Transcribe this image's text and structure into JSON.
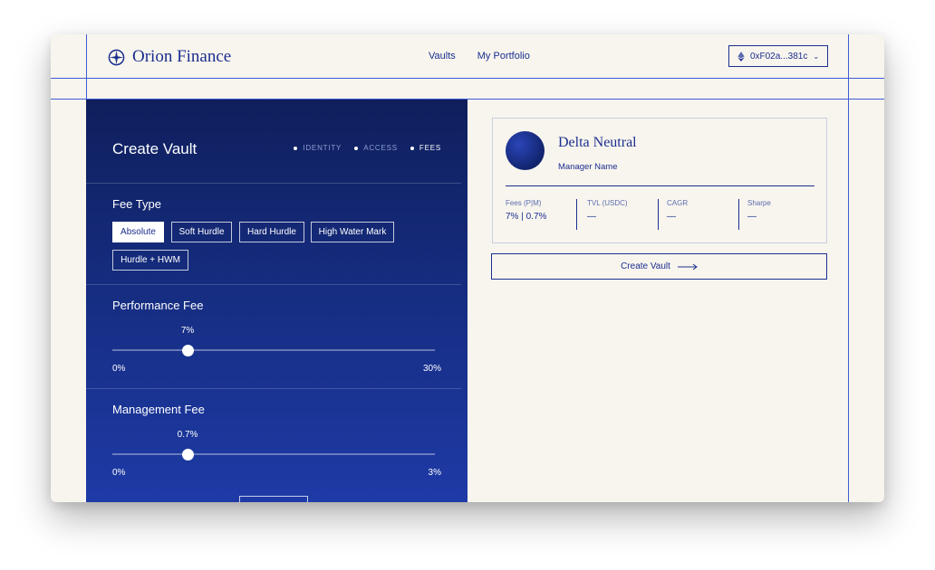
{
  "brand": {
    "name": "Orion Finance"
  },
  "nav": {
    "items": [
      "Vaults",
      "My Portfolio"
    ]
  },
  "wallet": {
    "address": "0xF02a...381c",
    "chevron": "⌄"
  },
  "create_panel": {
    "title": "Create Vault",
    "steps": [
      {
        "label": "IDENTITY",
        "active": false
      },
      {
        "label": "ACCESS",
        "active": false
      },
      {
        "label": "FEES",
        "active": true
      }
    ],
    "fee_type": {
      "title": "Fee Type",
      "options": [
        "Absolute",
        "Soft Hurdle",
        "Hard Hurdle",
        "High Water Mark",
        "Hurdle + HWM"
      ],
      "selected": "Absolute"
    },
    "performance_fee": {
      "title": "Performance Fee",
      "value": "7%",
      "min": "0%",
      "max": "30%",
      "fraction": 0.2333
    },
    "management_fee": {
      "title": "Management Fee",
      "value": "0.7%",
      "min": "0%",
      "max": "3%",
      "fraction": 0.2333
    }
  },
  "preview": {
    "vault_name": "Delta Neutral",
    "manager_name": "Manager Name",
    "stats": [
      {
        "label": "Fees (P|M)",
        "value": "7% | 0.7%"
      },
      {
        "label": "TVL (USDC)",
        "value": "—"
      },
      {
        "label": "CAGR",
        "value": "—"
      },
      {
        "label": "Sharpe",
        "value": "—"
      }
    ]
  },
  "actions": {
    "create_vault": "Create Vault"
  },
  "colors": {
    "accent": "#1b2f8f",
    "panel": "#172f86",
    "background": "#f8f5ee"
  }
}
